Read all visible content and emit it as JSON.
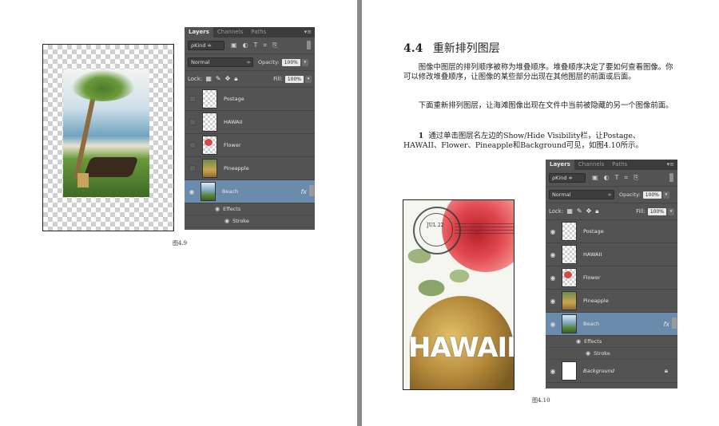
{
  "left_page": {
    "caption": "图4.9",
    "panel": {
      "tabs": [
        "Layers",
        "Channels",
        "Paths"
      ],
      "menu_icon": "▾≡",
      "filter": {
        "kind_label": "ρKind ≑"
      },
      "blend_mode": "Normal",
      "opacity_label": "Opacity:",
      "opacity_value": "100%",
      "lock_label": "Lock:",
      "fill_label": "Fill:",
      "fill_value": "100%",
      "layers": [
        {
          "name": "Postage",
          "visible": false
        },
        {
          "name": "HAWAII",
          "visible": false
        },
        {
          "name": "Flower",
          "visible": false
        },
        {
          "name": "Pineapple",
          "visible": false
        },
        {
          "name": "Beach",
          "visible": true,
          "selected": true,
          "fx": "fx"
        }
      ],
      "effects_label": "Effects",
      "stroke_label": "Stroke"
    }
  },
  "right_page": {
    "section_number": "4.4",
    "section_title": "重新排列图层",
    "para1": "图像中图层的排列顺序被称为堆叠顺序。堆叠顺序决定了要如何查看图像。你可以修改堆叠顺序，让图像的某些部分出现在其他图层的前面或后面。",
    "para2": "下面重新排列图层，让海滩图像出现在文件中当前被隐藏的另一个图像前面。",
    "step_number": "1",
    "step_text": "通过单击图层名左边的Show/Hide Visibility栏，让Postage、HAWAII、Flower、Pineapple和Background可见，如图4.10所示。",
    "caption": "图4.10",
    "poster": {
      "title": "HAWAII",
      "stamp_text": "JUL 22"
    },
    "panel": {
      "tabs": [
        "Layers",
        "Channels",
        "Paths"
      ],
      "menu_icon": "▾≡",
      "filter": {
        "kind_label": "ρKind ≑"
      },
      "blend_mode": "Normal",
      "opacity_label": "Opacity:",
      "opacity_value": "100%",
      "lock_label": "Lock:",
      "fill_label": "Fill:",
      "fill_value": "100%",
      "layers": [
        {
          "name": "Postage",
          "visible": true
        },
        {
          "name": "HAWAII",
          "visible": true
        },
        {
          "name": "Flower",
          "visible": true
        },
        {
          "name": "Pineapple",
          "visible": true
        },
        {
          "name": "Beach",
          "visible": true,
          "selected": true,
          "fx": "fx"
        }
      ],
      "effects_label": "Effects",
      "stroke_label": "Stroke",
      "background_layer": "Background"
    }
  }
}
